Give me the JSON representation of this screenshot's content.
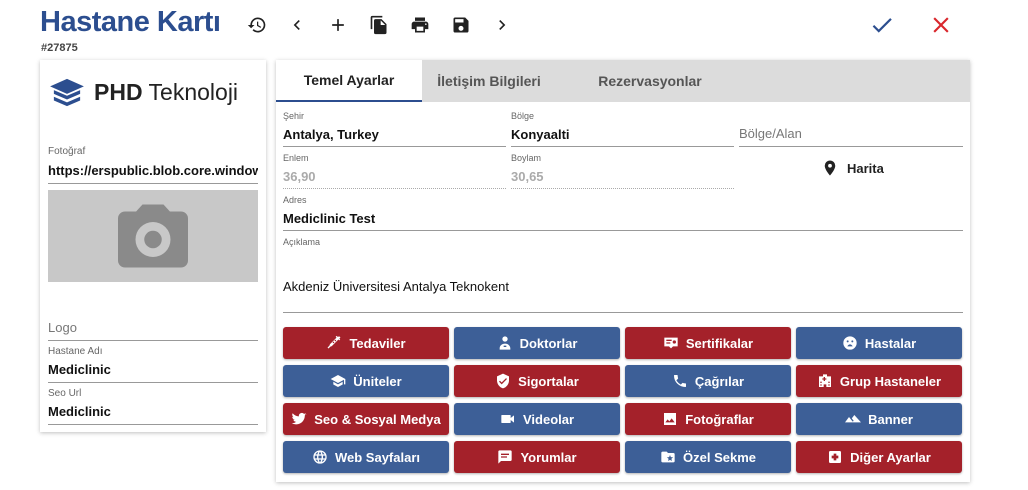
{
  "header": {
    "title": "Hastane Kartı",
    "record_id": "#27875"
  },
  "left": {
    "logo_brand": "PHD",
    "logo_rest": "Teknoloji",
    "photo_label": "Fotoğraf",
    "photo_value": "https://erspublic.blob.core.windows.net",
    "logo_placeholder": "Logo",
    "hospital_name_label": "Hastane Adı",
    "hospital_name_value": "Mediclinic",
    "seo_url_label": "Seo Url",
    "seo_url_value": "Mediclinic"
  },
  "tabs": [
    {
      "label": "Temel Ayarlar",
      "active": true
    },
    {
      "label": "İletişim Bilgileri",
      "active": false
    },
    {
      "label": "Rezervasyonlar",
      "active": false
    }
  ],
  "form": {
    "city_label": "Şehir",
    "city_value": "Antalya, Turkey",
    "region_label": "Bölge",
    "region_value": "Konyaalti",
    "region_area_placeholder": "Bölge/Alan",
    "lat_label": "Enlem",
    "lat_value": "36,90",
    "lon_label": "Boylam",
    "lon_value": "30,65",
    "map_label": "Harita",
    "address_label": "Adres",
    "address_value": "Mediclinic Test",
    "desc_label": "Açıklama",
    "desc_value": "Akdeniz Üniversitesi Antalya Teknokent"
  },
  "buttons": [
    {
      "label": "Tedaviler",
      "icon": "syringe-icon",
      "color": "#a4212a"
    },
    {
      "label": "Doktorlar",
      "icon": "doctor-icon",
      "color": "#3d5f97"
    },
    {
      "label": "Sertifikalar",
      "icon": "certificate-icon",
      "color": "#a4212a"
    },
    {
      "label": "Hastalar",
      "icon": "sick-face-icon",
      "color": "#3d5f97"
    },
    {
      "label": "Üniteler",
      "icon": "graduation-cap-icon",
      "color": "#3d5f97"
    },
    {
      "label": "Sigortalar",
      "icon": "shield-check-icon",
      "color": "#a4212a"
    },
    {
      "label": "Çağrılar",
      "icon": "phone-icon",
      "color": "#3d5f97"
    },
    {
      "label": "Grup Hastaneler",
      "icon": "hospital-icon",
      "color": "#a4212a"
    },
    {
      "label": "Seo & Sosyal Medya",
      "icon": "twitter-icon",
      "color": "#a4212a"
    },
    {
      "label": "Videolar",
      "icon": "video-icon",
      "color": "#3d5f97"
    },
    {
      "label": "Fotoğraflar",
      "icon": "image-icon",
      "color": "#a4212a"
    },
    {
      "label": "Banner",
      "icon": "mountain-icon",
      "color": "#3d5f97"
    },
    {
      "label": "Web Sayfaları",
      "icon": "globe-icon",
      "color": "#3d5f97"
    },
    {
      "label": "Yorumlar",
      "icon": "comment-icon",
      "color": "#a4212a"
    },
    {
      "label": "Özel Sekme",
      "icon": "star-folder-icon",
      "color": "#3d5f97"
    },
    {
      "label": "Diğer Ayarlar",
      "icon": "medical-box-icon",
      "color": "#a4212a"
    }
  ],
  "colors": {
    "primary_blue": "#2c4e8f",
    "button_red": "#a4212a",
    "button_blue": "#3d5f97",
    "confirm": "#2c4e8f",
    "cancel": "#d9262c"
  }
}
